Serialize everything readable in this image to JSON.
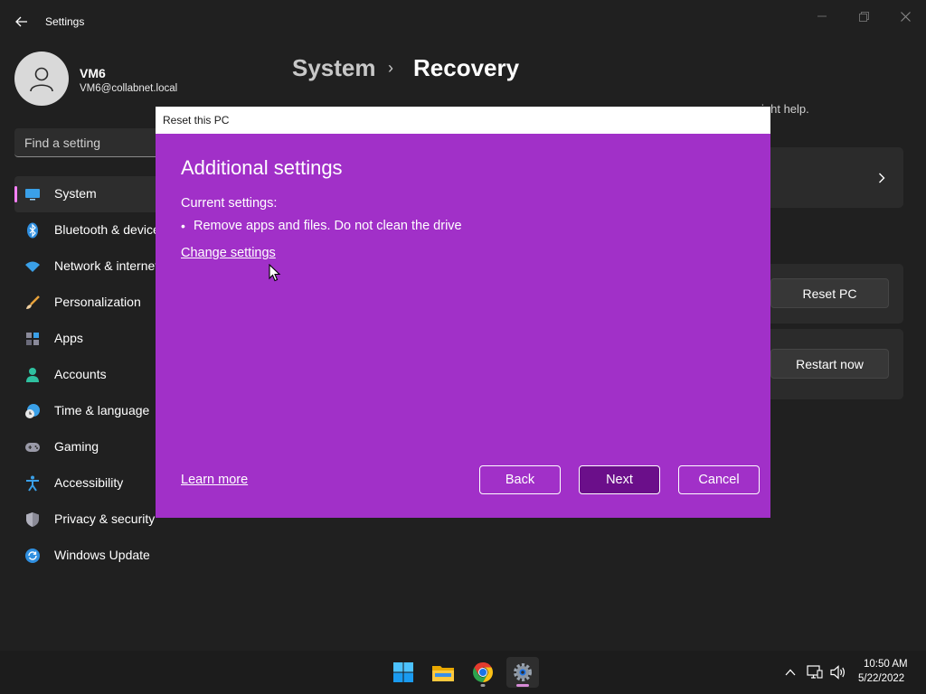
{
  "window": {
    "title": "Settings",
    "back_icon": "arrow-left-icon",
    "controls": [
      "minimize-icon",
      "restore-icon",
      "close-icon"
    ]
  },
  "profile": {
    "name": "VM6",
    "email": "VM6@collabnet.local",
    "avatar_icon": "person-icon"
  },
  "search": {
    "placeholder": "Find a setting"
  },
  "sidebar": {
    "items": [
      {
        "label": "System",
        "icon": "monitor-icon",
        "active": true
      },
      {
        "label": "Bluetooth & devices",
        "icon": "bluetooth-icon"
      },
      {
        "label": "Network & internet",
        "icon": "wifi-icon"
      },
      {
        "label": "Personalization",
        "icon": "brush-icon"
      },
      {
        "label": "Apps",
        "icon": "apps-icon"
      },
      {
        "label": "Accounts",
        "icon": "account-icon"
      },
      {
        "label": "Time & language",
        "icon": "clock-globe-icon"
      },
      {
        "label": "Gaming",
        "icon": "gamepad-icon"
      },
      {
        "label": "Accessibility",
        "icon": "accessibility-icon"
      },
      {
        "label": "Privacy & security",
        "icon": "shield-icon"
      },
      {
        "label": "Windows Update",
        "icon": "update-icon"
      }
    ],
    "accent_color": "#ff80ff"
  },
  "main": {
    "breadcrumb_parent": "System",
    "breadcrumb_separator": "›",
    "breadcrumb_current": "Recovery",
    "description_visible_tail": "ight help.",
    "reset_button": "Reset PC",
    "restart_button": "Restart now"
  },
  "dialog": {
    "title": "Reset this PC",
    "heading": "Additional settings",
    "current_label": "Current settings:",
    "bullet": "•",
    "current_value": "Remove apps and files. Do not clean the drive",
    "change_link": "Change settings",
    "learn_more": "Learn more",
    "back_button": "Back",
    "next_button": "Next",
    "cancel_button": "Cancel",
    "background_color": "#a130c8",
    "primary_button_color": "#6b0f8a"
  },
  "taskbar": {
    "apps": [
      "start-icon",
      "file-explorer-icon",
      "chrome-icon",
      "settings-icon"
    ],
    "tray": [
      "chevron-up-icon",
      "network-icon",
      "volume-icon"
    ],
    "time": "10:50 AM",
    "date": "5/22/2022"
  }
}
